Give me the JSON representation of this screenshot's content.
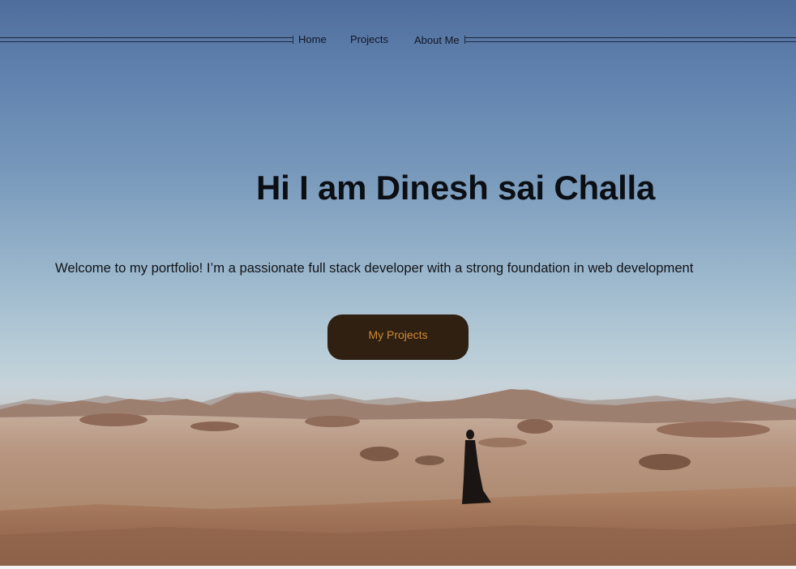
{
  "nav": {
    "items": [
      {
        "label": "Home"
      },
      {
        "label": "Projects"
      },
      {
        "label": "About Me"
      }
    ]
  },
  "hero": {
    "title": "Hi I am Dinesh sai Challa",
    "intro": "Welcome to my portfolio!  I’m a passionate full stack developer with a strong foundation in web development",
    "cta_label": "My Projects"
  },
  "colors": {
    "sky_top": "#4f6d9c",
    "sky_horizon": "#c6d3da",
    "desert": "#b08a72",
    "button_bg": "#2f2011",
    "button_text": "#d08a35",
    "text": "#0b0f14"
  }
}
